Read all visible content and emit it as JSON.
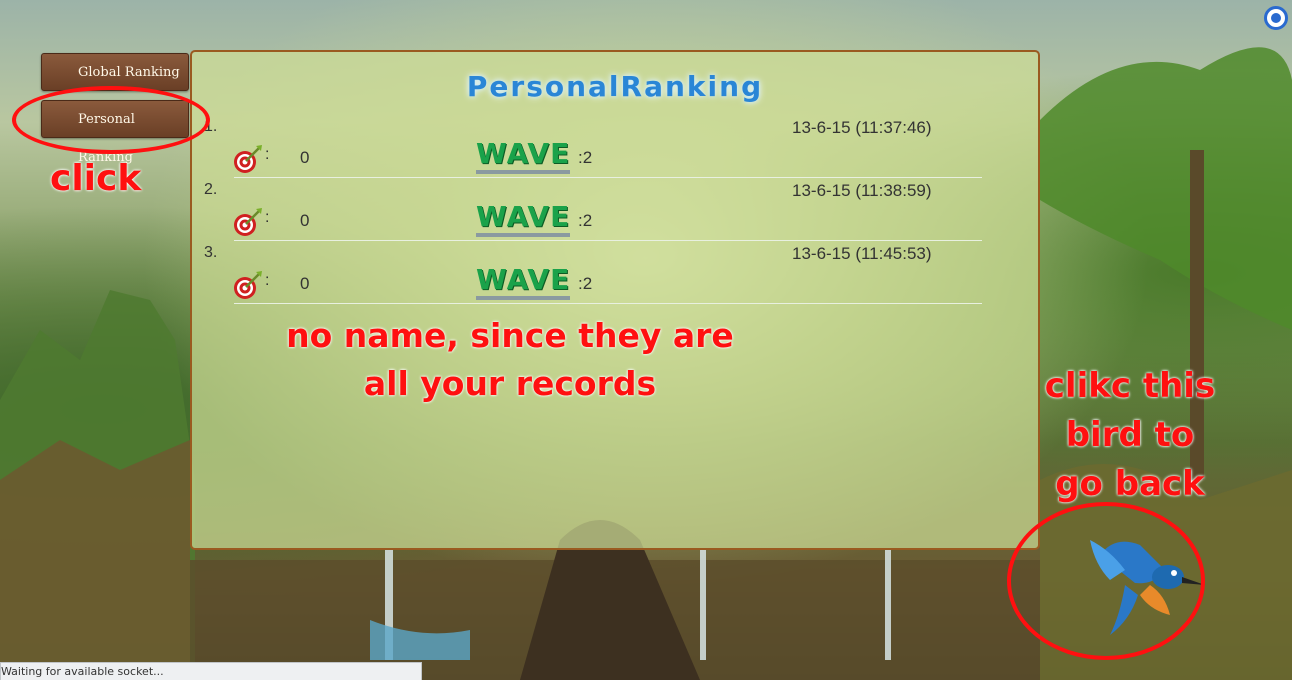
{
  "sidebar": {
    "tabs": [
      {
        "label": "Global Ranking"
      },
      {
        "label": "Personal Ranking"
      }
    ]
  },
  "panel": {
    "title": "PersonalRanking",
    "wave_label": "WAVE",
    "records": [
      {
        "rank": "1.",
        "time": "13-6-15 (11:37:46)",
        "score": "0",
        "wave": ":2"
      },
      {
        "rank": "2.",
        "time": "13-6-15 (11:38:59)",
        "score": "0",
        "wave": ":2"
      },
      {
        "rank": "3.",
        "time": "13-6-15 (11:45:53)",
        "score": "0",
        "wave": ":2"
      }
    ]
  },
  "annotations": {
    "click": "click",
    "records_line1": "no name, since they are",
    "records_line2": "all your records",
    "bird_line1": "clikc this",
    "bird_line2": "bird to",
    "bird_line3": "go back"
  },
  "status_bar": {
    "text": "Waiting for available socket..."
  },
  "colors": {
    "annotation": "#ff1010",
    "title": "#2a86d6",
    "wave": "#1aa24a",
    "panel_border": "#9a5a20",
    "tab": "#6a3f26"
  },
  "icons": {
    "score": "target-dart-icon",
    "back": "kingfisher-bird-icon",
    "corner": "round-button-icon"
  }
}
